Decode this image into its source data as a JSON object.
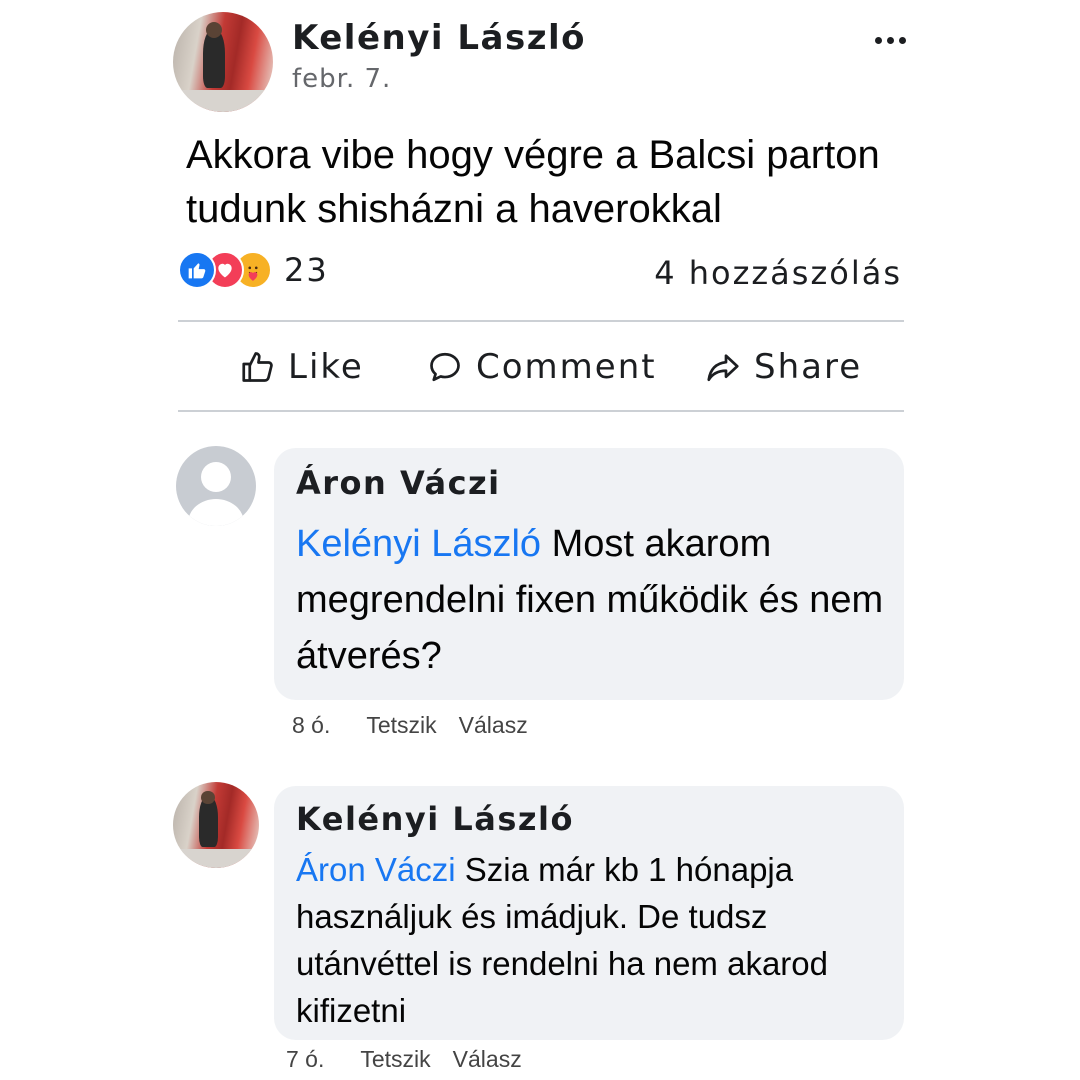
{
  "post": {
    "author": "Kelényi László",
    "date": "febr. 7.",
    "text": "Akkora vibe hogy végre a Balcsi parton tudunk shisházni a haverokkal",
    "reaction_count": "23",
    "comments_count": "4 hozzászólás",
    "reactions": [
      "like-react",
      "love-react",
      "care-react"
    ]
  },
  "actions": {
    "like": "Like",
    "comment": "Comment",
    "share": "Share"
  },
  "comments": [
    {
      "author": "Áron Váczi",
      "mention": "Kelényi László",
      "text": " Most akarom megrendelni fixen működik és nem átverés?",
      "time": "8 ó.",
      "like_label": "Tetszik",
      "reply_label": "Válasz"
    },
    {
      "author": "Kelényi László",
      "mention": "Áron Váczi",
      "text": " Szia már kb 1 hónapja használjuk és imádjuk. De tudsz utánvéttel is rendelni ha nem akarod kifizetni",
      "time": "7 ó.",
      "like_label": "Tetszik",
      "reply_label": "Válasz"
    }
  ],
  "colors": {
    "link_blue": "#1877f2",
    "bubble_bg": "#f0f2f5",
    "divider": "#ccd0d5",
    "secondary_text": "#65676b"
  }
}
